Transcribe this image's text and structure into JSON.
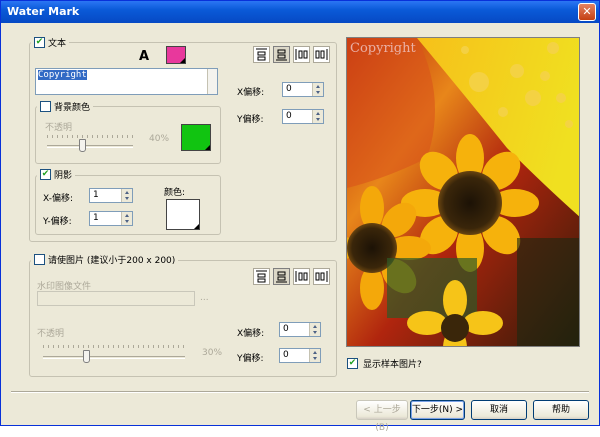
{
  "window": {
    "title": "Water Mark",
    "close_glyph": "✕"
  },
  "text_section": {
    "checkbox_label": "文本",
    "checked": true,
    "font_button": "A",
    "text_color": "#e8389c",
    "text_value": "Copyright",
    "x_offset_label": "X偏移:",
    "x_offset_value": "0",
    "y_offset_label": "Y偏移:",
    "y_offset_value": "0",
    "background_color": {
      "checkbox_label": "背景颜色",
      "checked": false,
      "opacity_label": "不透明",
      "opacity_value": "40%",
      "opacity_fraction": 0.4,
      "color": "#11c411"
    },
    "shadow": {
      "checkbox_label": "阴影",
      "checked": true,
      "x_offset_label": "X-偏移:",
      "x_offset_value": "1",
      "y_offset_label": "Y-偏移:",
      "y_offset_value": "1",
      "color_label": "颜色:",
      "color": "#ffffff"
    }
  },
  "image_section": {
    "checkbox_label": "请使图片 (建议小于200 x 200)",
    "checked": false,
    "file_label": "水印图像文件",
    "file_value": "",
    "browse_label": "...",
    "opacity_label": "不透明",
    "opacity_value": "30%",
    "opacity_fraction": 0.3,
    "x_offset_label": "X偏移:",
    "x_offset_value": "0",
    "y_offset_label": "Y偏移:",
    "y_offset_value": "0"
  },
  "preview": {
    "watermark_text": "Copyright",
    "show_sample_label": "显示样本图片?",
    "show_sample_checked": true
  },
  "buttons": {
    "back": "< 上一步(B)",
    "next": "下一步(N) >",
    "cancel": "取消",
    "help": "帮助"
  },
  "colors": {
    "title_bar": "#0a5ad8",
    "dialog_bg": "#ece9d8",
    "selection": "#316ac5"
  }
}
